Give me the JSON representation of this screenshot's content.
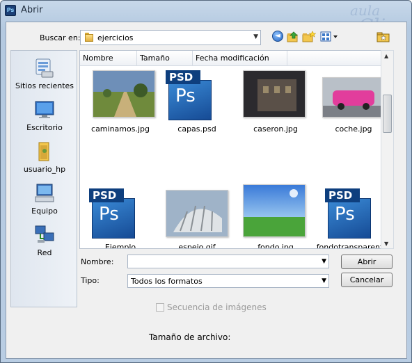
{
  "window": {
    "title": "Abrir",
    "app_icon": "Ps"
  },
  "watermark": {
    "text1": "aula",
    "text2": "Clic"
  },
  "lookin": {
    "label": "Buscar en:",
    "value": "ejercicios"
  },
  "toolbar": {
    "back_icon": "back-arrow-icon",
    "up_icon": "up-folder-icon",
    "new_folder_icon": "new-folder-icon",
    "view_icon": "view-menu-icon",
    "favorites_icon": "favorite-folder-icon"
  },
  "places": [
    {
      "label": "Sitios recientes",
      "icon": "recent-places-icon"
    },
    {
      "label": "Escritorio",
      "icon": "desktop-icon"
    },
    {
      "label": "usuario_hp",
      "icon": "user-folder-icon"
    },
    {
      "label": "Equipo",
      "icon": "computer-icon"
    },
    {
      "label": "Red",
      "icon": "network-icon"
    }
  ],
  "columns": [
    "Nombre",
    "Tamaño",
    "Fecha modificación"
  ],
  "files": [
    {
      "name": "caminamos.jpg",
      "kind": "photo-road"
    },
    {
      "name": "capas.psd",
      "kind": "psd"
    },
    {
      "name": "caseron.jpg",
      "kind": "photo-house"
    },
    {
      "name": "coche.jpg",
      "kind": "photo-car"
    },
    {
      "name": "Ejemplo",
      "kind": "psd"
    },
    {
      "name": "espejo.gif",
      "kind": "photo-building"
    },
    {
      "name": "fondo.jpg",
      "kind": "photo-landscape"
    },
    {
      "name": "fondotransparent…",
      "kind": "psd"
    }
  ],
  "psd_label": "PSD",
  "ps_label": "Ps",
  "filename": {
    "label": "Nombre:",
    "value": ""
  },
  "filetype": {
    "label": "Tipo:",
    "value": "Todos los formatos"
  },
  "buttons": {
    "open": "Abrir",
    "cancel": "Cancelar"
  },
  "sequence": {
    "label": "Secuencia de imágenes",
    "checked": false,
    "enabled": false
  },
  "filesize_label": "Tamaño de archivo:"
}
